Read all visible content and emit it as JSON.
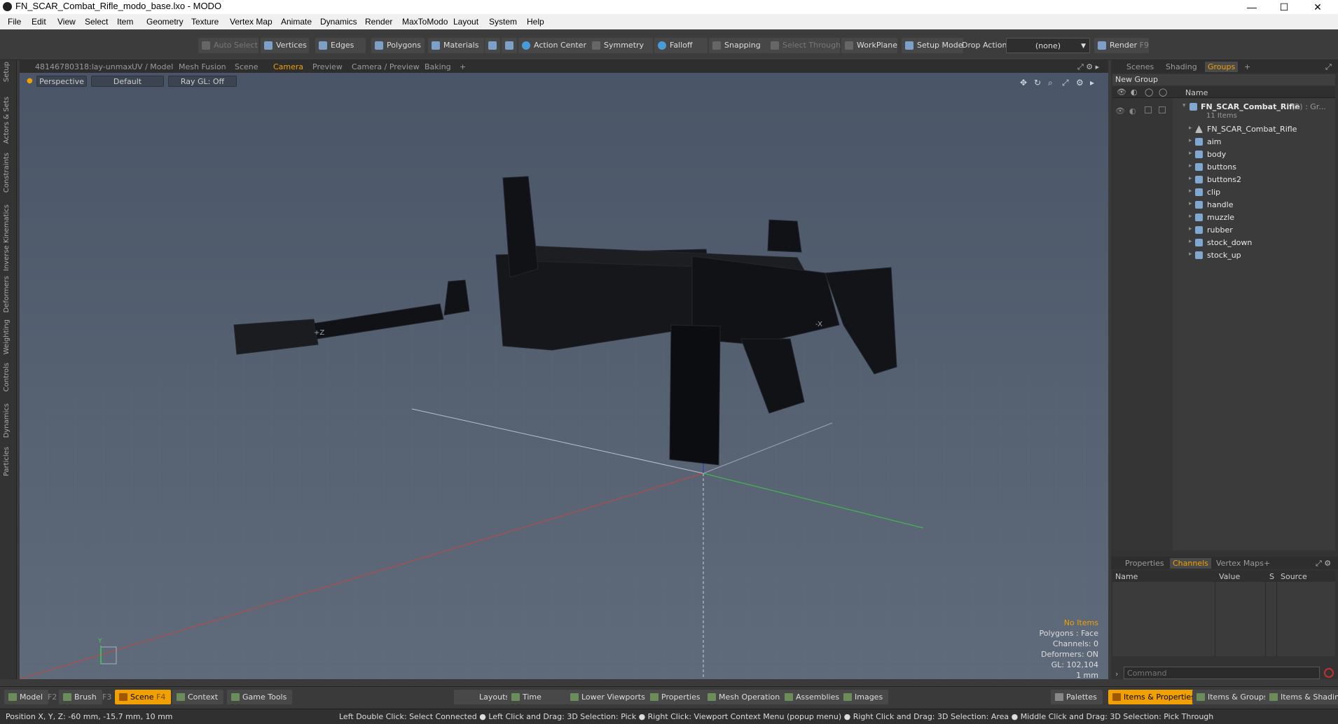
{
  "window": {
    "title": "FN_SCAR_Combat_Rifle_modo_base.lxo - MODO",
    "minimize": "—",
    "maximize": "☐",
    "close": "✕"
  },
  "menu": [
    "File",
    "Edit",
    "View",
    "Select",
    "Item",
    "Geometry",
    "Texture",
    "Vertex Map",
    "Animate",
    "Dynamics",
    "Render",
    "MaxToModo",
    "Layout",
    "System",
    "Help"
  ],
  "toolbar": {
    "auto_select": "Auto Select",
    "vertices": "Vertices",
    "edges": "Edges",
    "polygons": "Polygons",
    "materials": "Materials",
    "action_center": "Action Center",
    "symmetry": "Symmetry",
    "falloff": "Falloff",
    "snapping": "Snapping",
    "select_through": "Select Through",
    "workplane": "WorkPlane",
    "setup_mode": "Setup Mode",
    "drop_action": "Drop Action",
    "drop_value": "(none)",
    "render": "Render",
    "render_key": "F9"
  },
  "viewport_tabs": {
    "t0": "48146780318:lay-unmax",
    "t1": "UV / Model",
    "t2": "Mesh Fusion",
    "t3": "Scene",
    "t4": "Camera",
    "t5": "Preview",
    "t6": "Camera / Preview",
    "t7": "Baking",
    "add": "+"
  },
  "viewport": {
    "view": "Perspective",
    "shading": "Default",
    "raygl": "Ray GL: Off",
    "axis_z": "+Z",
    "axis_x": "-X",
    "gizmo_y": "Y",
    "stats": {
      "items": "No Items",
      "polygons": "Polygons : Face",
      "channels": "Channels: 0",
      "deformers": "Deformers: ON",
      "gl": "GL: 102,104",
      "unit": "1 mm"
    }
  },
  "left_tabs": [
    "Setup",
    "Actors & Sets",
    "Constraints",
    "Inverse Kinematics",
    "Deformers",
    "Weighting",
    "Controls",
    "Dynamics",
    "Particles"
  ],
  "scene_panel": {
    "tabs": {
      "scenes": "Scenes",
      "shading": "Shading",
      "groups": "Groups",
      "add": "+"
    },
    "new_group": "New Group",
    "col_name": "Name",
    "root": "FN_SCAR_Combat_Rifle",
    "root_suffix": "(2) : Gr...",
    "root_count": "11 Items",
    "items": [
      "FN_SCAR_Combat_Rifle",
      "aim",
      "body",
      "buttons",
      "buttons2",
      "clip",
      "handle",
      "muzzle",
      "rubber",
      "stock_down",
      "stock_up"
    ]
  },
  "props_panel": {
    "tabs": {
      "properties": "Properties",
      "channels": "Channels",
      "vertex_maps": "Vertex Maps",
      "add": "+"
    },
    "cols": {
      "name": "Name",
      "value": "Value",
      "s": "S",
      "source": "Source"
    }
  },
  "command_placeholder": "Command",
  "bottom": {
    "model": "Model",
    "f2": "F2",
    "brush": "Brush",
    "f3": "F3",
    "scene": "Scene",
    "f4": "F4",
    "context": "Context",
    "game_tools": "Game Tools",
    "layouts": "Layouts",
    "time": "Time",
    "lower_viewports": "Lower Viewports",
    "properties": "Properties",
    "mesh_operations": "Mesh Operations",
    "assemblies": "Assemblies",
    "images": "Images",
    "palettes": "Palettes",
    "items_properties": "Items & Properties",
    "items_groups": "Items & Groups",
    "items_shading": "Items & Shading"
  },
  "status": {
    "position": "Position X, Y, Z:   -60 mm, -15.7 mm, 10 mm",
    "hint": "Left Double Click: Select Connected ● Left Click and Drag: 3D Selection: Pick ● Right Click: Viewport Context Menu (popup menu) ● Right Click and Drag: 3D Selection: Area ● Middle Click and Drag: 3D Selection: Pick Through"
  }
}
